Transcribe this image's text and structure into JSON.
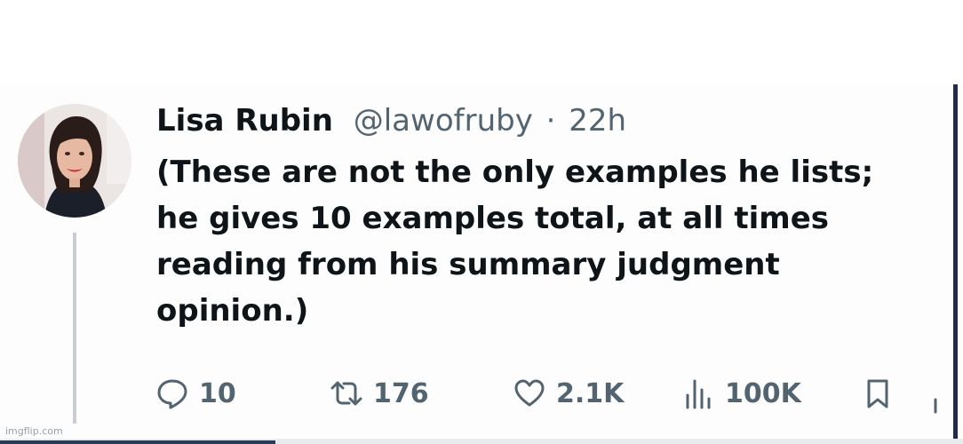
{
  "tweet": {
    "author_name": "Lisa Rubin",
    "author_handle": "@lawofruby",
    "separator": "·",
    "timestamp": "22h",
    "text_lines": [
      "(These are not the only examples he lists;",
      "he gives 10 examples total, at all times",
      "reading from his summary judgment",
      "opinion.)"
    ]
  },
  "actions": {
    "reply": {
      "icon": "reply-icon",
      "count": "10"
    },
    "retweet": {
      "icon": "retweet-icon",
      "count": "176"
    },
    "like": {
      "icon": "heart-icon",
      "count": "2.1K"
    },
    "views": {
      "icon": "views-icon",
      "count": "100K"
    },
    "bookmark": {
      "icon": "bookmark-icon"
    }
  },
  "watermark": "imgflip.com",
  "colors": {
    "text_primary": "#0f1419",
    "text_secondary": "#536471",
    "thread_line": "#c9cdd1"
  }
}
